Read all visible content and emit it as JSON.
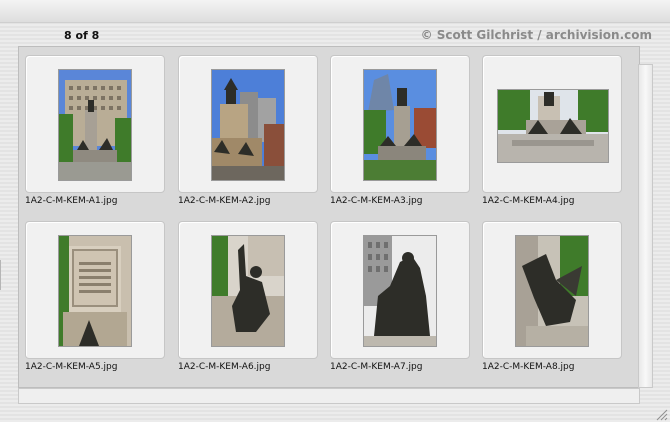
{
  "header": {
    "count_text": "8 of 8",
    "credit_text": "© Scott Gilchrist / archivision.com"
  },
  "thumbnails": [
    {
      "filename": "1A2-C-M-KEM-A1.jpg",
      "icon": "monument-building-photo"
    },
    {
      "filename": "1A2-C-M-KEM-A2.jpg",
      "icon": "monument-skyline-photo"
    },
    {
      "filename": "1A2-C-M-KEM-A3.jpg",
      "icon": "monument-tower-photo"
    },
    {
      "filename": "1A2-C-M-KEM-A4.jpg",
      "icon": "monument-plaza-photo"
    },
    {
      "filename": "1A2-C-M-KEM-A5.jpg",
      "icon": "monument-inscription-photo"
    },
    {
      "filename": "1A2-C-M-KEM-A6.jpg",
      "icon": "seated-figure-photo"
    },
    {
      "filename": "1A2-C-M-KEM-A7.jpg",
      "icon": "figure-group-photo"
    },
    {
      "filename": "1A2-C-M-KEM-A8.jpg",
      "icon": "winged-figure-photo"
    }
  ],
  "colors": {
    "sky": "#3b6fd6",
    "stone": "#c9bfae",
    "foliage": "#3f7b2a",
    "bronze": "#2d2d28"
  }
}
